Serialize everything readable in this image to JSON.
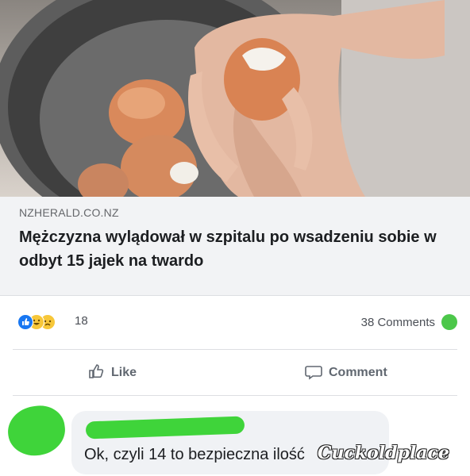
{
  "post": {
    "photo_alt": "hands peeling boiled eggs in a metal pot",
    "link": {
      "domain": "NZHERALD.CO.NZ",
      "headline": "Mężczyzna wylądował w szpitalu po wsadzeniu sobie w odbyt 15 jajek na twardo"
    },
    "stats": {
      "reaction_count": "18",
      "reactions": [
        "like",
        "haha",
        "sad"
      ],
      "comments_label": "38 Comments"
    },
    "actions": {
      "like_label": "Like",
      "comment_label": "Comment"
    }
  },
  "comment": {
    "text": "Ok, czyli 14 to bezpieczna ilość",
    "censor_color": "#3fd43a"
  },
  "watermark": {
    "text": "Cuckoldplace"
  },
  "colors": {
    "like_blue": "#1877f2",
    "haha_yellow": "#f7c739",
    "text_dark": "#1c1e21",
    "text_muted": "#65676b"
  }
}
